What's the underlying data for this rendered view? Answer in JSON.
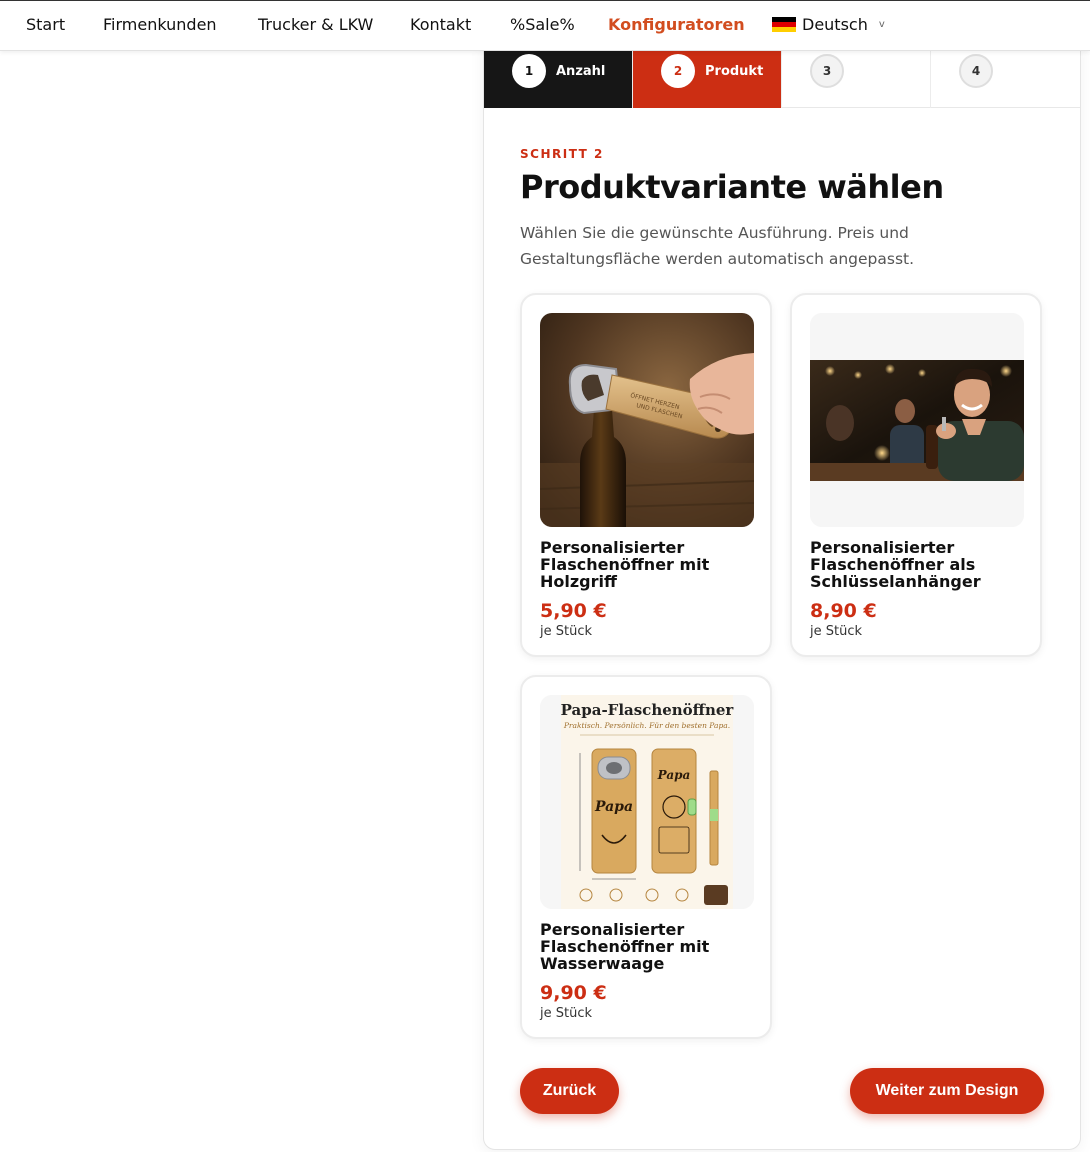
{
  "nav": {
    "items": [
      "Start",
      "Firmenkunden",
      "Trucker & LKW",
      "Kontakt",
      "%Sale%",
      "Konfiguratoren"
    ],
    "active": "Konfiguratoren",
    "language": "Deutsch"
  },
  "steps": [
    {
      "number": "1",
      "label": "Anzahl",
      "state": "done"
    },
    {
      "number": "2",
      "label": "Produkt",
      "state": "current"
    },
    {
      "number": "3",
      "label": "",
      "state": "pending"
    },
    {
      "number": "4",
      "label": "",
      "state": "pending"
    }
  ],
  "header": {
    "eyebrow": "SCHRITT 2",
    "title": "Produktvariante wählen",
    "subtitle": "Wählen Sie die gewünschte Ausführung. Preis und Gestaltungsfläche werden automatisch angepasst."
  },
  "products": [
    {
      "name": "Personalisierter Flaschenöffner mit Holzgriff",
      "price": "5,90 €",
      "unit": "je Stück",
      "engraving": "ÖFFNET HERZEN UND FLASCHEN"
    },
    {
      "name": "Personalisierter Flaschenöffner als Schlüsselanhänger",
      "price": "8,90 €",
      "unit": "je Stück"
    },
    {
      "name": "Personalisierter Flaschenöffner mit Wasserwaage",
      "price": "9,90 €",
      "unit": "je Stück",
      "promo_title": "Papa-Flaschenöffner",
      "promo_subtitle": "Praktisch. Persönlich. Für den besten Papa.",
      "promo_word": "Papa"
    }
  ],
  "buttons": {
    "back": "Zurück",
    "next": "Weiter zum Design"
  },
  "colors": {
    "accent": "#cc2e13",
    "nav_active": "#d24d1f",
    "step_done": "#161616"
  }
}
